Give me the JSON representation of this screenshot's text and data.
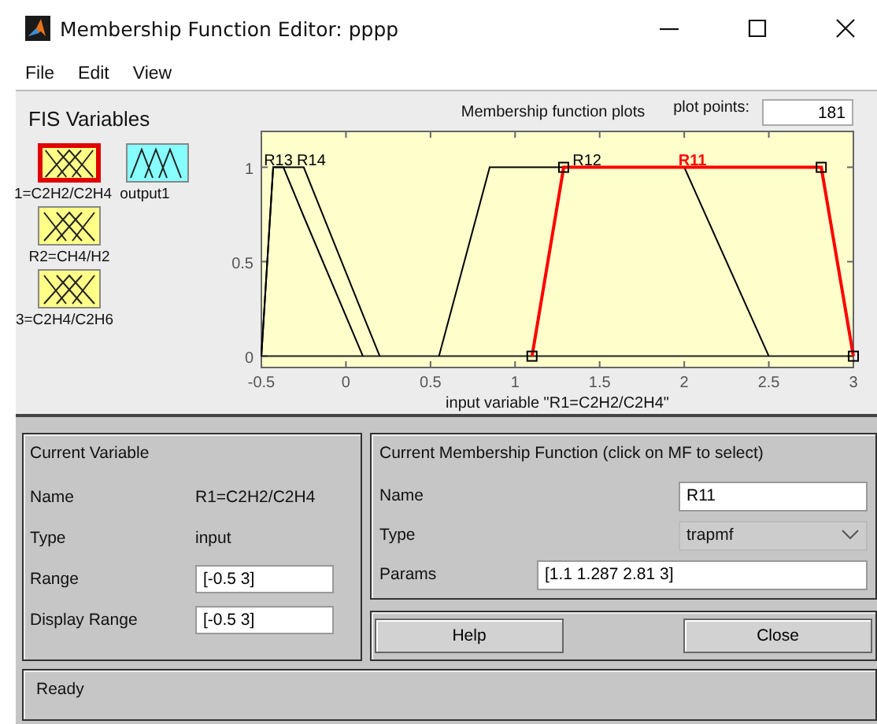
{
  "window": {
    "title": "Membership Function Editor: pppp"
  },
  "menu": [
    "File",
    "Edit",
    "View"
  ],
  "fis_variables": {
    "title": "FIS Variables",
    "items": [
      {
        "label": "1=C2H2/C2H4",
        "kind": "input",
        "selected": true
      },
      {
        "label": "output1",
        "kind": "output",
        "selected": false
      },
      {
        "label": "R2=CH4/H2",
        "kind": "input",
        "selected": false
      },
      {
        "label": "3=C2H4/C2H6",
        "kind": "input",
        "selected": false
      }
    ]
  },
  "plot": {
    "plot_points_label": "plot points:",
    "plot_points": "181",
    "curves": [
      {
        "selected": false
      },
      {
        "selected": false
      },
      {
        "selected": false
      },
      {
        "selected": true
      }
    ],
    "chart_data": {
      "type": "line",
      "title": "Membership function plots",
      "xlabel": "input variable \"R1=C2H2/C2H4\"",
      "x": [
        -0.5,
        -0.43,
        -0.37,
        -0.25,
        0.1,
        0.2,
        0.55,
        0.85,
        1.1,
        1.287,
        2,
        2.5,
        2.81,
        3
      ],
      "series": [
        {
          "name": "R13",
          "color": "#000000",
          "values": [
            0,
            1,
            1,
            0.74,
            0,
            null,
            null,
            null,
            null,
            null,
            null,
            null,
            null,
            null
          ]
        },
        {
          "name": "R14",
          "color": "#000000",
          "values": [
            0,
            1,
            1,
            1,
            0.22,
            0,
            null,
            null,
            null,
            null,
            null,
            null,
            null,
            null
          ]
        },
        {
          "name": "R12",
          "color": "#000000",
          "values": [
            null,
            null,
            null,
            null,
            null,
            null,
            0,
            1,
            1,
            1,
            1,
            0,
            null,
            null
          ]
        },
        {
          "name": "R11",
          "color": "#ff0000",
          "values": [
            null,
            null,
            null,
            null,
            null,
            null,
            null,
            null,
            0,
            1,
            1,
            1,
            1,
            0
          ]
        }
      ],
      "xlim": [
        -0.5,
        3
      ],
      "ylim": [
        -0.06,
        1.19
      ],
      "xticks": [
        -0.5,
        0,
        0.5,
        1,
        1.5,
        2,
        2.5,
        3
      ],
      "yticks": [
        0,
        0.5,
        1
      ]
    }
  },
  "current_variable": {
    "title": "Current Variable",
    "name_label": "Name",
    "name": "R1=C2H2/C2H4",
    "type_label": "Type",
    "type": "input",
    "range_label": "Range",
    "range": "[-0.5 3]",
    "display_range_label": "Display Range",
    "display_range": "[-0.5 3]"
  },
  "current_mf": {
    "title": "Current Membership Function (click on MF to select)",
    "name_label": "Name",
    "name": "R11",
    "type_label": "Type",
    "type": "trapmf",
    "params_label": "Params",
    "params": "[1.1 1.287 2.81 3]"
  },
  "buttons": [
    "Help",
    "Close"
  ],
  "status_bar": "Ready"
}
